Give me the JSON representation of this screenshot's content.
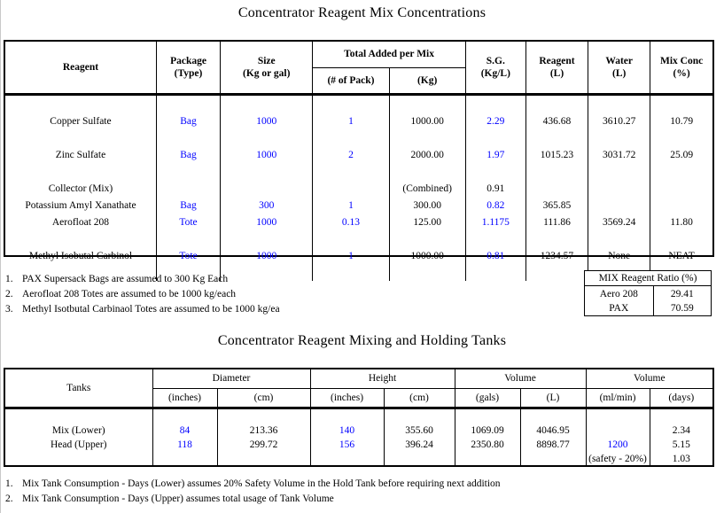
{
  "document": {
    "title_1": "Concentrator Reagent Mix Concentrations",
    "title_2": "Concentrator Reagent Mixing and Holding Tanks",
    "accent_blue": "#0000FF",
    "text_black": "#000000"
  },
  "table1": {
    "headers": {
      "reagent": "Reagent",
      "package": "Package",
      "package_unit": "(Type)",
      "size": "Size",
      "size_unit": "(Kg or gal)",
      "total_added": "Total Added per Mix",
      "total_added_pack": "(# of Pack)",
      "total_added_kg": "(Kg)",
      "sg": "S.G.",
      "sg_unit": "(Kg/L)",
      "reagent_vol": "Reagent",
      "reagent_vol_unit": "(L)",
      "water": "Water",
      "water_unit": "(L)",
      "mix_conc": "Mix Conc",
      "mix_conc_unit": "(%)"
    },
    "rows": [
      {
        "reagent": "Copper Sulfate",
        "package": "Bag",
        "size": "1000",
        "pack_count": "1",
        "kg": "1000.00",
        "sg": "2.29",
        "reagent_l": "436.68",
        "water_l": "3610.27",
        "mix_conc": "10.79"
      },
      {
        "reagent": "Zinc Sulfate",
        "package": "Bag",
        "size": "1000",
        "pack_count": "2",
        "kg": "2000.00",
        "sg": "1.97",
        "reagent_l": "1015.23",
        "water_l": "3031.72",
        "mix_conc": "25.09"
      },
      {
        "reagent": "Collector (Mix)",
        "package": "",
        "size": "",
        "pack_count": "",
        "kg": "(Combined)",
        "sg": "0.91",
        "reagent_l": "",
        "water_l": "",
        "mix_conc": ""
      },
      {
        "reagent": "Potassium Amyl Xanathate",
        "package": "Bag",
        "size": "300",
        "pack_count": "1",
        "kg": "300.00",
        "sg": "0.82",
        "reagent_l": "365.85",
        "water_l": "",
        "mix_conc": ""
      },
      {
        "reagent": "Aerofloat 208",
        "package": "Tote",
        "size": "1000",
        "pack_count": "0.13",
        "kg": "125.00",
        "sg": "1.1175",
        "reagent_l": "111.86",
        "water_l": "3569.24",
        "mix_conc": "11.80"
      },
      {
        "reagent": "Methyl Isobutal Carbinol",
        "package": "Tote",
        "size": "1000",
        "pack_count": "1",
        "kg": "1000.00",
        "sg": "0.81",
        "reagent_l": "1234.57",
        "water_l": "None",
        "mix_conc": "NEAT"
      }
    ]
  },
  "notes1": [
    {
      "num": "1.",
      "text": "PAX Supersack Bags are assumed to 300 Kg Each"
    },
    {
      "num": "2.",
      "text": "Aerofloat 208 Totes are assumed to be 1000 kg/each"
    },
    {
      "num": "3.",
      "text": "Methyl Isotbutal Carbinaol Totes are assumed to be 1000 kg/ea"
    }
  ],
  "ratio_table": {
    "header": "MIX Reagent Ratio (%)",
    "rows": [
      {
        "label": "Aero 208",
        "value": "29.41"
      },
      {
        "label": "PAX",
        "value": "70.59"
      }
    ]
  },
  "table2": {
    "headers": {
      "tanks": "Tanks",
      "diameter": "Diameter",
      "diameter_in": "(inches)",
      "diameter_cm": "(cm)",
      "height": "Height",
      "height_in": "(inches)",
      "height_cm": "(cm)",
      "volume_a": "Volume",
      "volume_gals": "(gals)",
      "volume_l": "(L)",
      "volume_b": "Volume",
      "volume_mlmin": "(ml/min)",
      "volume_days": "(days)"
    },
    "rows": [
      {
        "tank": "Mix (Lower)",
        "dia_in": "84",
        "dia_cm": "213.36",
        "hgt_in": "140",
        "hgt_cm": "355.60",
        "vol_gals": "1069.09",
        "vol_l": "4046.95",
        "ml_min": "",
        "days": "2.34"
      },
      {
        "tank": "Head  (Upper)",
        "dia_in": "118",
        "dia_cm": "299.72",
        "hgt_in": "156",
        "hgt_cm": "396.24",
        "vol_gals": "2350.80",
        "vol_l": "8898.77",
        "ml_min": "1200",
        "days": "5.15"
      },
      {
        "tank": "",
        "dia_in": "",
        "dia_cm": "",
        "hgt_in": "",
        "hgt_cm": "",
        "vol_gals": "",
        "vol_l": "",
        "ml_min": "(safety - 20%)",
        "days": "1.03"
      }
    ]
  },
  "notes2": [
    {
      "num": "1.",
      "text": "Mix Tank Consumption - Days (Lower) assumes 20% Safety Volume in the Hold Tank before requiring next addition"
    },
    {
      "num": "2.",
      "text": "Mix Tank Consumption - Days (Upper) assumes total usage of Tank Volume"
    }
  ]
}
